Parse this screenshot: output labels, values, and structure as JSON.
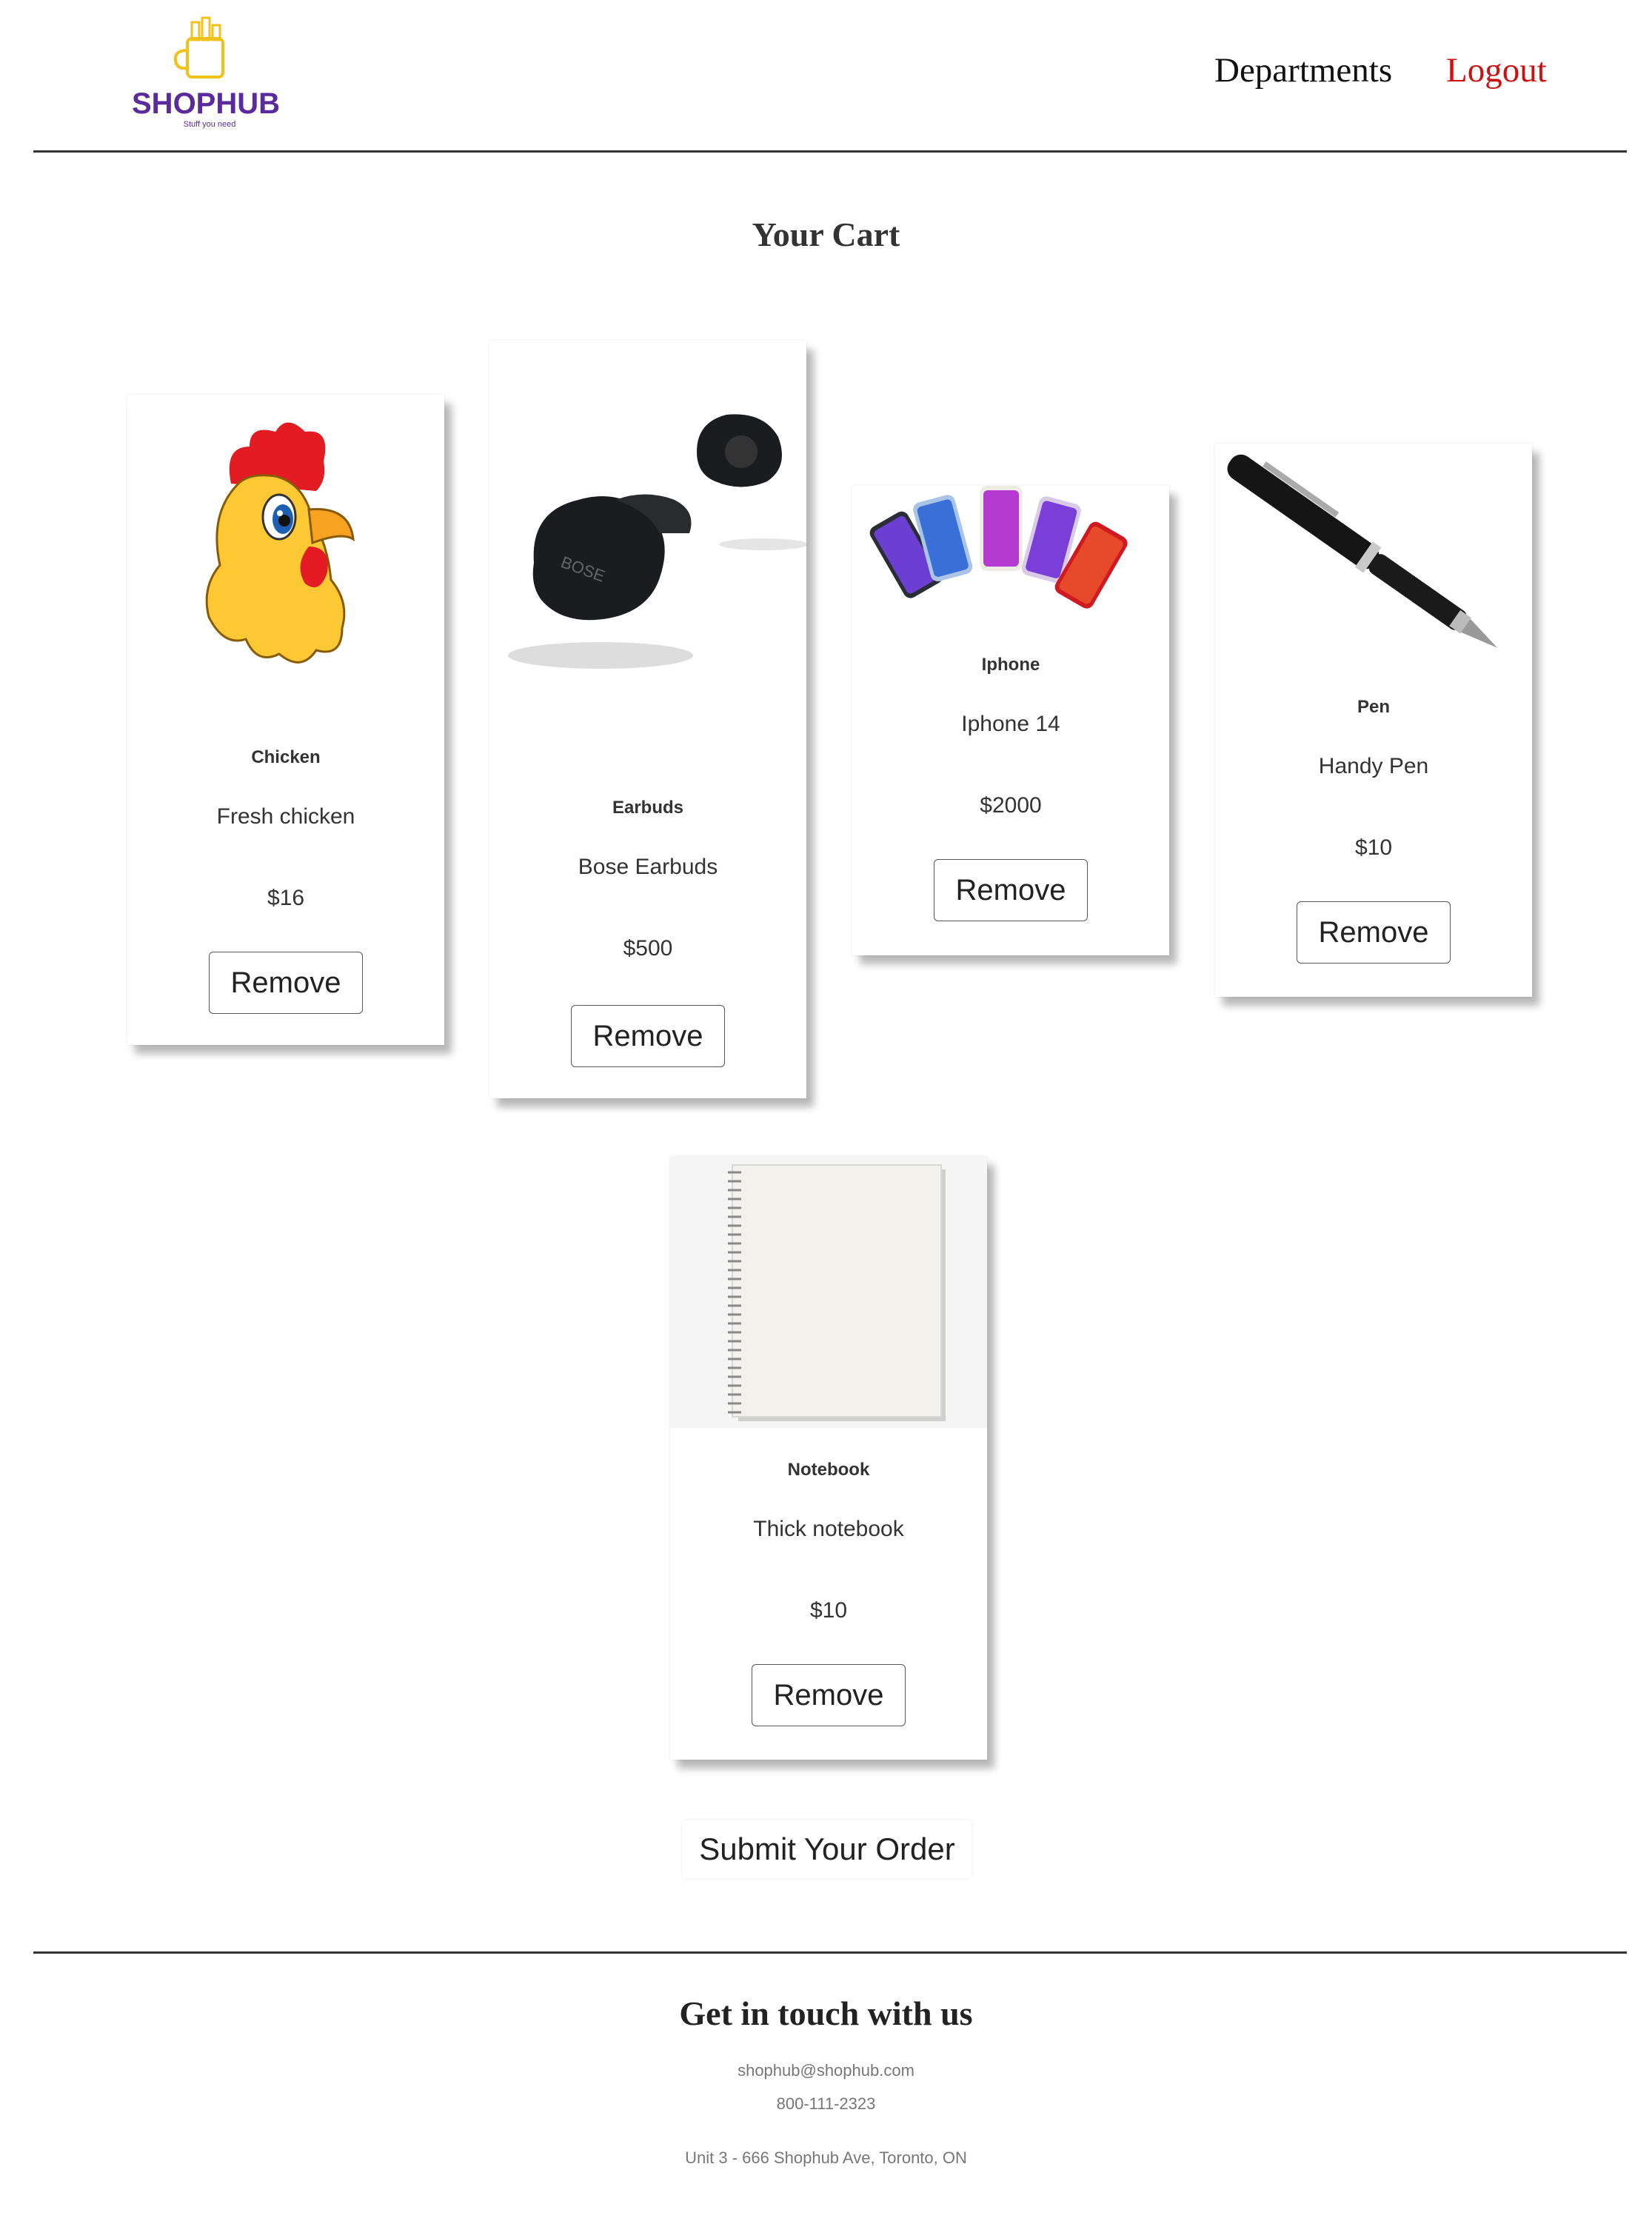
{
  "brand": {
    "name": "SHOPHUB",
    "tagline": "Stuff you need",
    "color": "#5b2a9c"
  },
  "nav": {
    "departments": "Departments",
    "logout": "Logout",
    "logout_color": "#cc1111"
  },
  "page": {
    "title": "Your Cart"
  },
  "cart": {
    "items": [
      {
        "name": "Chicken",
        "description": "Fresh chicken",
        "price": "$16",
        "remove_label": "Remove",
        "image_icon": "chicken-image"
      },
      {
        "name": "Earbuds",
        "description": "Bose Earbuds",
        "price": "$500",
        "remove_label": "Remove",
        "image_icon": "earbuds-image"
      },
      {
        "name": "Iphone",
        "description": "Iphone 14",
        "price": "$2000",
        "remove_label": "Remove",
        "image_icon": "iphone-image"
      },
      {
        "name": "Pen",
        "description": "Handy Pen",
        "price": "$10",
        "remove_label": "Remove",
        "image_icon": "pen-image"
      },
      {
        "name": "Notebook",
        "description": "Thick notebook",
        "price": "$10",
        "remove_label": "Remove",
        "image_icon": "notebook-image"
      }
    ],
    "submit_label": "Submit Your Order"
  },
  "footer": {
    "title": "Get in touch with us",
    "email": "shophub@shophub.com",
    "phone": "800-111-2323",
    "address": "Unit 3 - 666 Shophub Ave, Toronto, ON"
  }
}
